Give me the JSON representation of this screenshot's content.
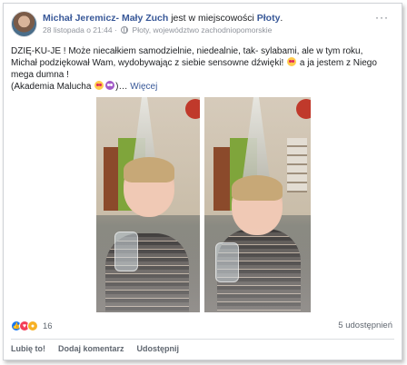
{
  "post": {
    "author": "Michał Jeremicz- Mały Zuch",
    "action_text": "jest w miejscowości",
    "place": "Płoty",
    "place_suffix": ".",
    "timestamp": "28 listopada o 21:44",
    "separator": "·",
    "location": "Płoty, województwo zachodniopomorskie",
    "more_options": "···",
    "text_line1": "DZIĘ-KU-JE ! Może niecałkiem samodzielnie, niedealnie, tak- sylabami, ale w tym roku,",
    "text_line2a": "Michał podziękował Wam, wydobywając z siebie sensowne dźwięki!",
    "text_line2b": "a ja jestem z Niego",
    "text_line3": "mega dumna !",
    "text_line4": "(Akademia Malucha",
    "text_ellipsis": ")…",
    "more_link": "Więcej"
  },
  "engagement": {
    "reaction_count": "16",
    "shares": "5 udostępnień"
  },
  "actions": {
    "like": "Lubię to!",
    "comment": "Dodaj komentarz",
    "share": "Udostępnij"
  },
  "colors": {
    "link": "#385898",
    "meta": "#90949c",
    "like": "#1877f2",
    "love": "#f33e58"
  },
  "icons": {
    "avatar": "avatar",
    "globe": "globe-icon",
    "like_reaction": "like-reaction-icon",
    "love_reaction": "love-reaction-icon",
    "wow_reaction": "wow-reaction-icon"
  }
}
